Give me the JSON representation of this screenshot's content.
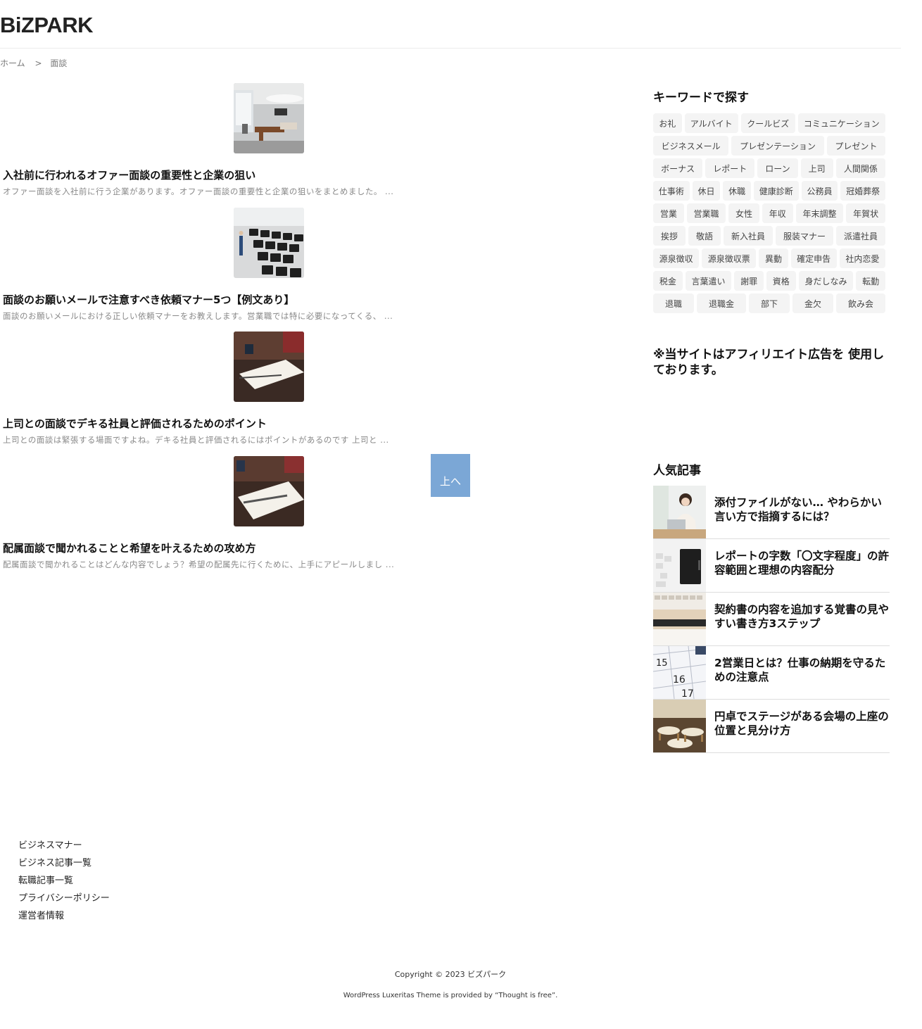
{
  "header": {
    "logo": "BiZPARK"
  },
  "breadcrumb": {
    "home": "ホーム",
    "separator": ">",
    "current": "面談"
  },
  "posts": [
    {
      "title": "入社前に行われるオファー面談の重要性と企業の狙い",
      "excerpt": "オファー面談を入社前に行う企業があります。オファー面談の重要性と企業の狙いをまとめました。 ..."
    },
    {
      "title": "面談のお願いメールで注意すべき依頼マナー5つ【例文あり】",
      "excerpt": "面談のお願いメールにおける正しい依頼マナーをお教えします。営業職では特に必要になってくる、 ..."
    },
    {
      "title": "上司との面談でデキる社員と評価されるためのポイント",
      "excerpt": "上司との面談は緊張する場面ですよね。デキる社員と評価されるにはポイントがあるのです 上司と ..."
    },
    {
      "title": "配属面談で聞かれることと希望を叶えるための攻め方",
      "excerpt": "配属面談で聞かれることはどんな内容でしょう？希望の配属先に行くために、上手にアピールしまし ..."
    }
  ],
  "to_top": "上へ",
  "sidebar": {
    "keyword_title": "キーワードで探す",
    "tag_rows": [
      [
        "お礼",
        "アルバイト",
        "クールビズ",
        "コミュニケーション"
      ],
      [
        "ビジネスメール",
        "プレゼンテーション",
        "プレゼント"
      ],
      [
        "ボーナス",
        "レポート",
        "ローン",
        "上司",
        "人間関係"
      ],
      [
        "仕事術",
        "休日",
        "休職",
        "健康診断",
        "公務員",
        "冠婚葬祭"
      ],
      [
        "営業",
        "営業職",
        "女性",
        "年収",
        "年末調整",
        "年賀状"
      ],
      [
        "挨拶",
        "敬語",
        "新入社員",
        "服装マナー",
        "派遣社員"
      ],
      [
        "源泉徴収",
        "源泉徴収票",
        "異動",
        "確定申告",
        "社内恋愛"
      ],
      [
        "税金",
        "言葉遣い",
        "謝罪",
        "資格",
        "身だしなみ",
        "転勤"
      ],
      [
        "退職",
        "退職金",
        "部下",
        "金欠",
        "飲み会"
      ]
    ],
    "notice": "※当サイトはアフィリエイト広告を 使用しております。",
    "popular_title": "人気記事",
    "popular": [
      {
        "title": "添付ファイルがない… やわらかい言い方で指摘するには？"
      },
      {
        "title": "レポートの字数「〇文字程度」の許容範囲と理想の内容配分"
      },
      {
        "title": "契約書の内容を追加する覚書の見やすい書き方3ステップ"
      },
      {
        "title": "2営業日とは？仕事の納期を守るための注意点"
      },
      {
        "title": "円卓でステージがある会場の上座の位置と見分け方"
      }
    ]
  },
  "footer": {
    "links": [
      "ビジネスマナー",
      "ビジネス記事一覧",
      "転職記事一覧",
      "プライバシーポリシー",
      "運営者情報"
    ],
    "copyright": "Copyright © 2023 ビズパーク",
    "credit": "WordPress Luxeritas Theme is provided by “Thought is free”."
  }
}
